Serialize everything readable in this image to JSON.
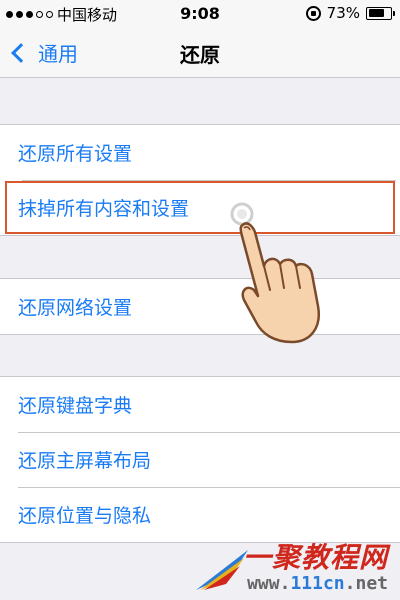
{
  "status_bar": {
    "carrier": "中国移动",
    "time": "9:08",
    "battery_percent": "73%",
    "battery_level": 0.73
  },
  "nav": {
    "back_label": "通用",
    "title": "还原"
  },
  "groups": [
    {
      "items": [
        "还原所有设置",
        "抹掉所有内容和设置"
      ]
    },
    {
      "items": [
        "还原网络设置"
      ]
    },
    {
      "items": [
        "还原键盘字典",
        "还原主屏幕布局",
        "还原位置与隐私"
      ]
    }
  ],
  "highlighted_item": "抹掉所有内容和设置",
  "colors": {
    "accent": "#1a7cf5",
    "highlight_border": "#d9572c",
    "background": "#efeff4"
  },
  "watermark": {
    "title": "一聚教程网",
    "url_prefix": "www.",
    "url_main": "111cn",
    "url_suffix": ".net"
  }
}
